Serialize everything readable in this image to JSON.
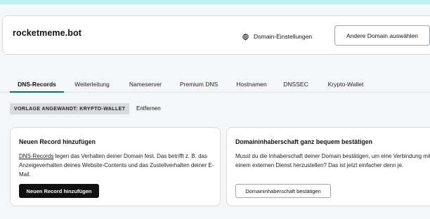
{
  "domain": {
    "name": "rocketmeme.bot",
    "settings_label": "Domain-Einstellungen",
    "settings_icon": "gear-icon",
    "other_domain_label": "Andere Domain auswählen"
  },
  "tabs": [
    {
      "label": "DNS-Records",
      "active": true
    },
    {
      "label": "Weiterleitung",
      "active": false
    },
    {
      "label": "Nameserver",
      "active": false
    },
    {
      "label": "Premium DNS",
      "active": false
    },
    {
      "label": "Hostnamen",
      "active": false
    },
    {
      "label": "DNSSEC",
      "active": false
    },
    {
      "label": "Krypto-Wallet",
      "active": false
    }
  ],
  "template": {
    "badge": "VORLAGE ANGEWANDT: KRYPTO-WALLET",
    "remove_label": "Entfernen"
  },
  "add_record_card": {
    "title": "Neuen Record hinzufügen",
    "link_text": "DNS-Records",
    "text": " legen das Verhalten deiner Domain fest. Das betrifft z. B. das Anzeigeverhalten deines Website-Contents und das Zustellverhalten deiner E-Mail.",
    "button_label": "Neuen Record hinzufügen"
  },
  "ownership_card": {
    "title": "Domaininhaberschaft ganz bequem bestätigen",
    "text": "Musst du die Inhaberschaft deiner Domain bestätigen, um eine Verbindung mit einem externen Dienst herzustellen? Das ist jetzt einfacher denn je.",
    "button_label": "Domaininhaberschaft bestätigen"
  },
  "colors": {
    "accent": "#0a6d6b",
    "top_strip": "#bdf1ef",
    "dark_button": "#111111"
  }
}
